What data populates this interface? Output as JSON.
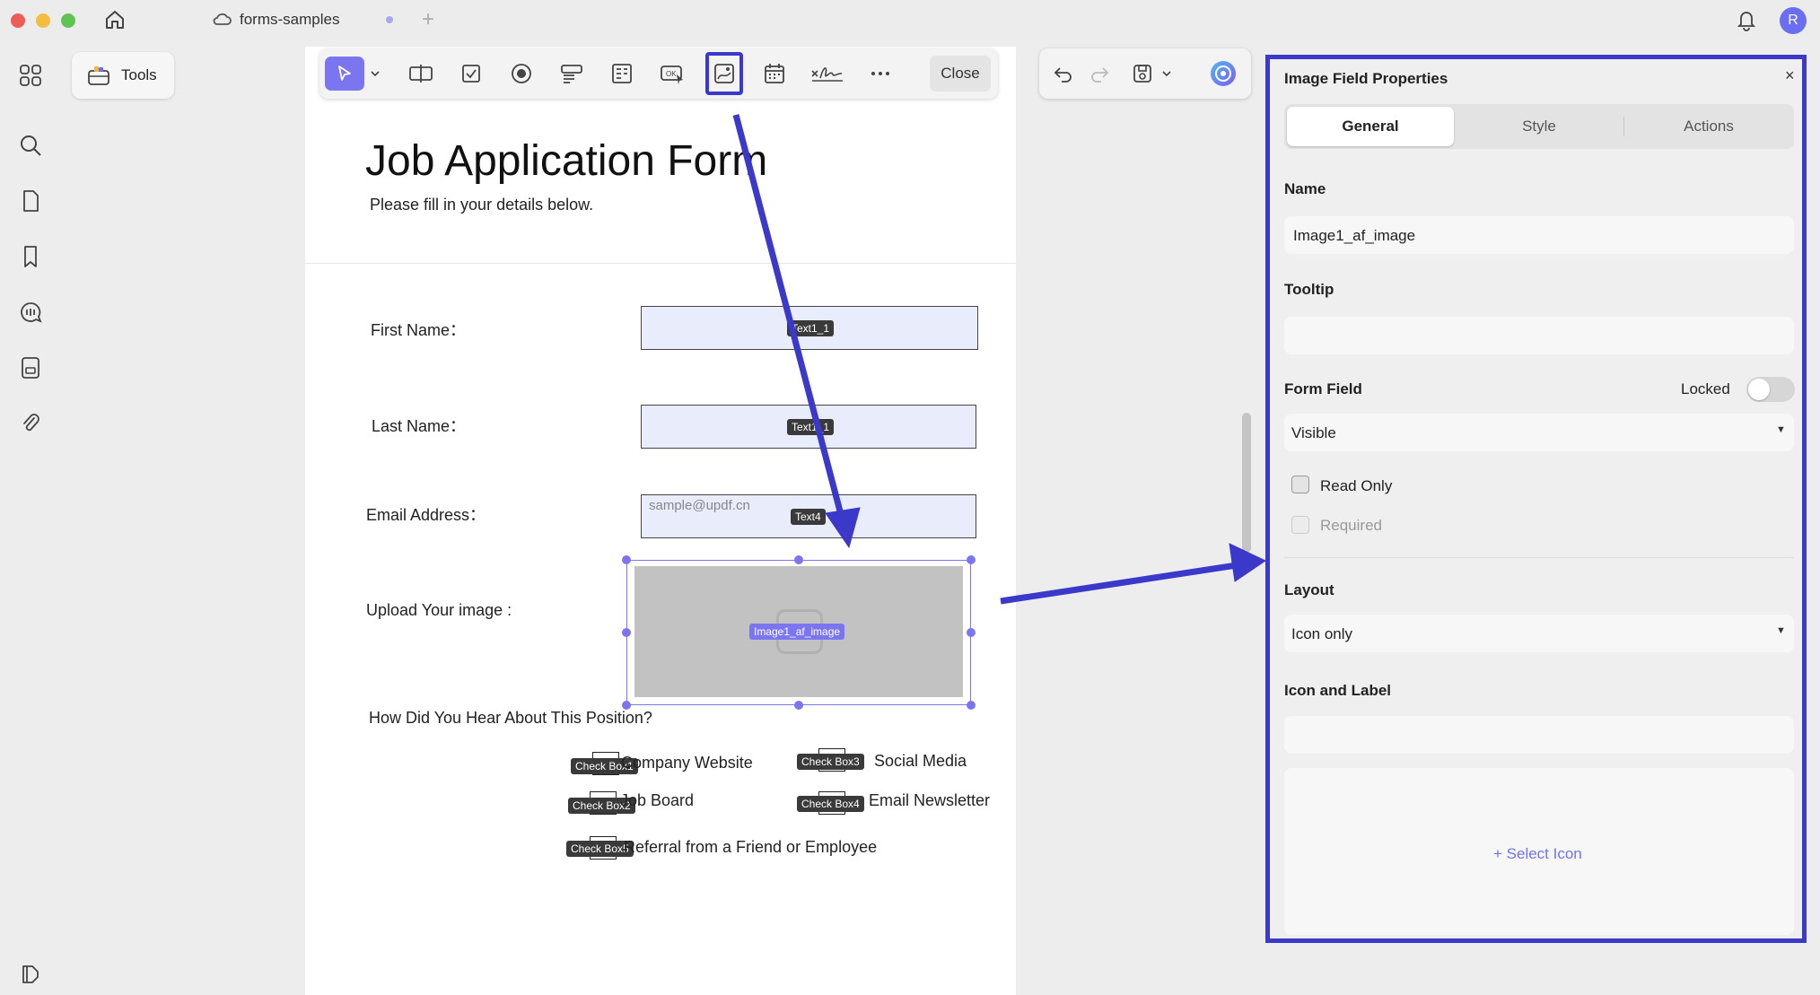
{
  "window": {
    "tab_title": "forms-samples",
    "avatar_initial": "R"
  },
  "toolbar": {
    "tools_label": "Tools",
    "close_label": "Close"
  },
  "form": {
    "title": "Job Application Form",
    "subtitle": "Please fill in your details below.",
    "first_name_label": "First Name：",
    "first_name_tag": "Text1_1",
    "last_name_label": "Last Name：",
    "last_name_tag": "Text1_1",
    "email_label": "Email Address：",
    "email_placeholder": "sample@updf.cn",
    "email_tag": "Text4",
    "upload_label": "Upload Your image :",
    "image_tag": "Image1_af_image",
    "hear_question": "How Did You Hear About This Position?",
    "options": [
      {
        "tag": "Check Box1",
        "text": "Company Website"
      },
      {
        "tag": "Check Box3",
        "text": "Social Media"
      },
      {
        "tag": "Check Box2",
        "text": "Job Board"
      },
      {
        "tag": "Check Box4",
        "text": "Email Newsletter"
      },
      {
        "tag": "Check Box5",
        "text": "Referral from a Friend or Employee"
      }
    ]
  },
  "panel": {
    "title": "Image Field Properties",
    "tabs": [
      "General",
      "Style",
      "Actions"
    ],
    "name_label": "Name",
    "name_value": "Image1_af_image",
    "tooltip_label": "Tooltip",
    "tooltip_value": "",
    "form_field_label": "Form Field",
    "locked_label": "Locked",
    "visibility_value": "Visible",
    "read_only_label": "Read Only",
    "required_label": "Required",
    "layout_label": "Layout",
    "layout_value": "Icon only",
    "icon_label_label": "Icon and Label",
    "select_icon_label": "+ Select Icon"
  },
  "colors": {
    "annotation_blue": "#3b39c9",
    "accent": "#7b76f0",
    "field_bg": "#e8ecfb"
  }
}
